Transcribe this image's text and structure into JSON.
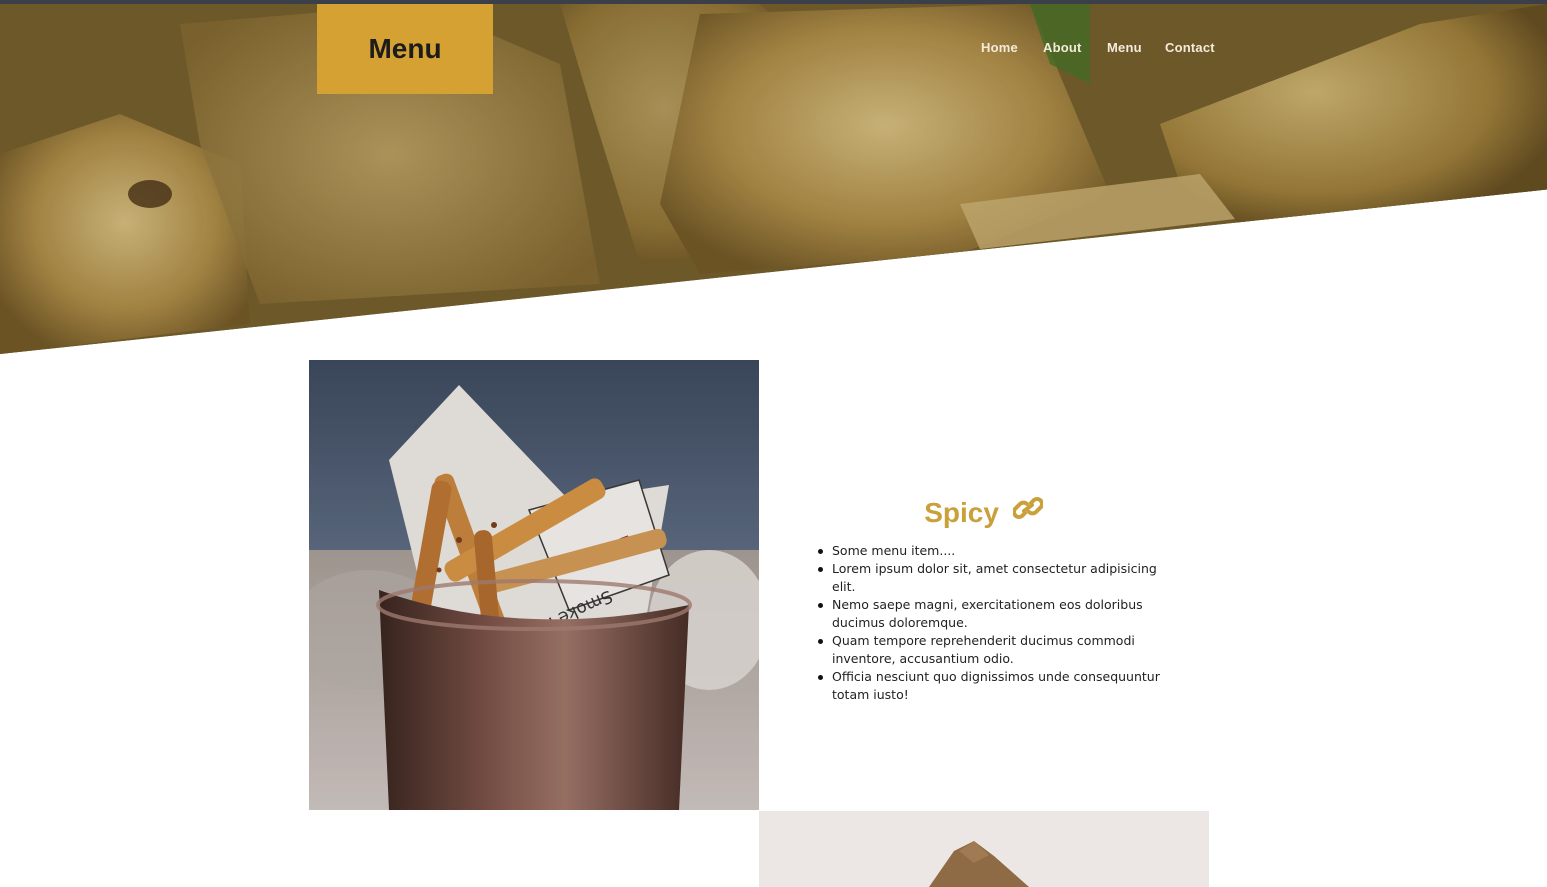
{
  "brand": {
    "label": "Menu"
  },
  "nav": {
    "items": [
      {
        "label": "Home"
      },
      {
        "label": "About"
      },
      {
        "label": "Menu"
      },
      {
        "label": "Contact"
      }
    ]
  },
  "section": {
    "title": "Spicy",
    "title_icon": "link-icon",
    "items": [
      "Some menu item....",
      "Lorem ipsum dolor sit, amet consectetur adipisicing elit.",
      "Nemo saepe magni, exercitationem eos doloribus ducimus doloremque.",
      "Quam tempore reprehenderit ducimus commodi inventore, accusantium odio.",
      "Officia nesciunt quo dignissimos unde consequuntur totam iusto!"
    ]
  },
  "photos": {
    "hero": "fried-potato-wedges",
    "primary": "fries-in-copper-cup",
    "secondary": "paper-wrapped-food"
  },
  "colors": {
    "accent": "#d4a132",
    "title": "#c9a03a",
    "topbar": "#3b3f4a"
  }
}
